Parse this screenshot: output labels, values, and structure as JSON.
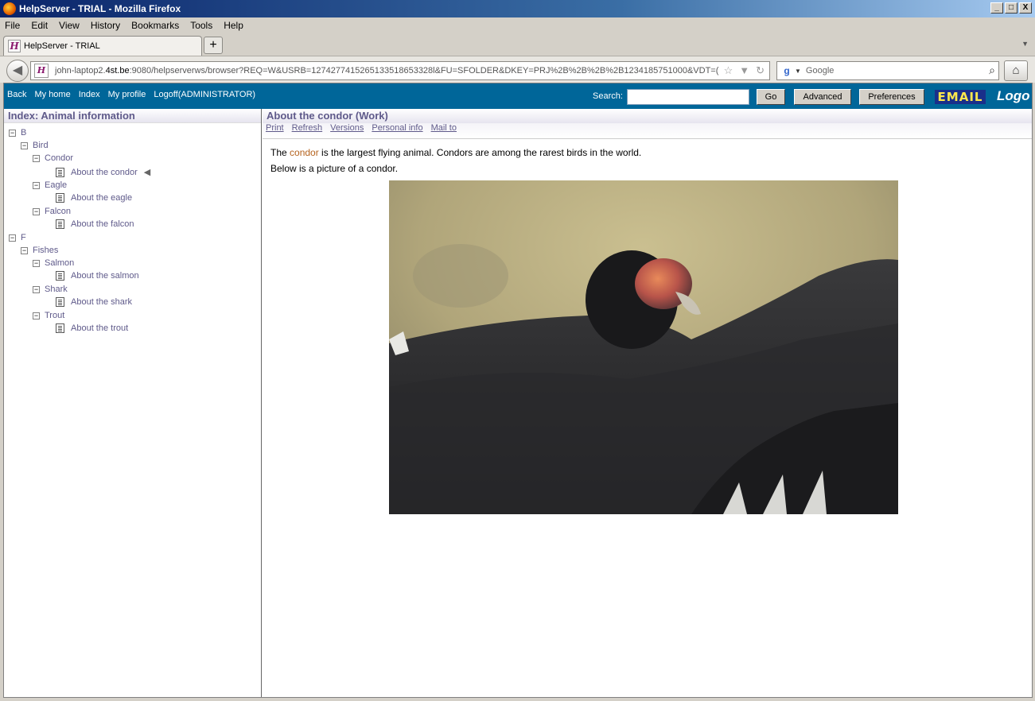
{
  "window": {
    "title": "HelpServer - TRIAL - Mozilla Firefox",
    "buttons": [
      "_",
      "□",
      "X"
    ]
  },
  "menu": [
    "File",
    "Edit",
    "View",
    "History",
    "Bookmarks",
    "Tools",
    "Help"
  ],
  "tab": {
    "label": "HelpServer - TRIAL",
    "new_tab": "+"
  },
  "nav": {
    "url_prefix": "john-laptop2.",
    "url_host": "4st.be",
    "url_rest": ":9080/helpserverws/browser?REQ=W&USRB=1274277415265133518653328l&FU=SFOLDER&DKEY=PRJ%2B%2B%2B%2B1234185751000&VDT=(",
    "search_placeholder": "Google"
  },
  "app": {
    "links": [
      "Back",
      "My home",
      "Index",
      "My profile",
      "Logoff(ADMINISTRATOR)"
    ],
    "search_label": "Search:",
    "search_value": "",
    "go": "Go",
    "advanced": "Advanced",
    "preferences": "Preferences",
    "email": "EMAIL",
    "logo": "Logo"
  },
  "index": {
    "title": "Index: Animal information",
    "nodes": [
      {
        "label": "B",
        "type": "folder",
        "level": 0
      },
      {
        "label": "Bird",
        "type": "folder",
        "level": 1
      },
      {
        "label": "Condor",
        "type": "folder",
        "level": 2
      },
      {
        "label": "About the condor",
        "type": "doc",
        "level": 3,
        "current": true
      },
      {
        "label": "Eagle",
        "type": "folder",
        "level": 2
      },
      {
        "label": "About the eagle",
        "type": "doc",
        "level": 3
      },
      {
        "label": "Falcon",
        "type": "folder",
        "level": 2
      },
      {
        "label": "About the falcon",
        "type": "doc",
        "level": 3
      },
      {
        "label": "F",
        "type": "folder",
        "level": 0
      },
      {
        "label": "Fishes",
        "type": "folder",
        "level": 1
      },
      {
        "label": "Salmon",
        "type": "folder",
        "level": 2
      },
      {
        "label": "About the salmon",
        "type": "doc",
        "level": 3
      },
      {
        "label": "Shark",
        "type": "folder",
        "level": 2
      },
      {
        "label": "About the shark",
        "type": "doc",
        "level": 3
      },
      {
        "label": "Trout",
        "type": "folder",
        "level": 2
      },
      {
        "label": "About the trout",
        "type": "doc",
        "level": 3
      }
    ]
  },
  "document": {
    "title": "About the condor (Work)",
    "actions": [
      "Print",
      "Refresh",
      "Versions",
      "Personal info",
      "Mail to"
    ],
    "line1_pre": "The ",
    "line1_link": "condor",
    "line1_post": " is the largest flying animal. Condors are among the rarest birds in the world.",
    "line2": "Below is a picture of a condor."
  }
}
